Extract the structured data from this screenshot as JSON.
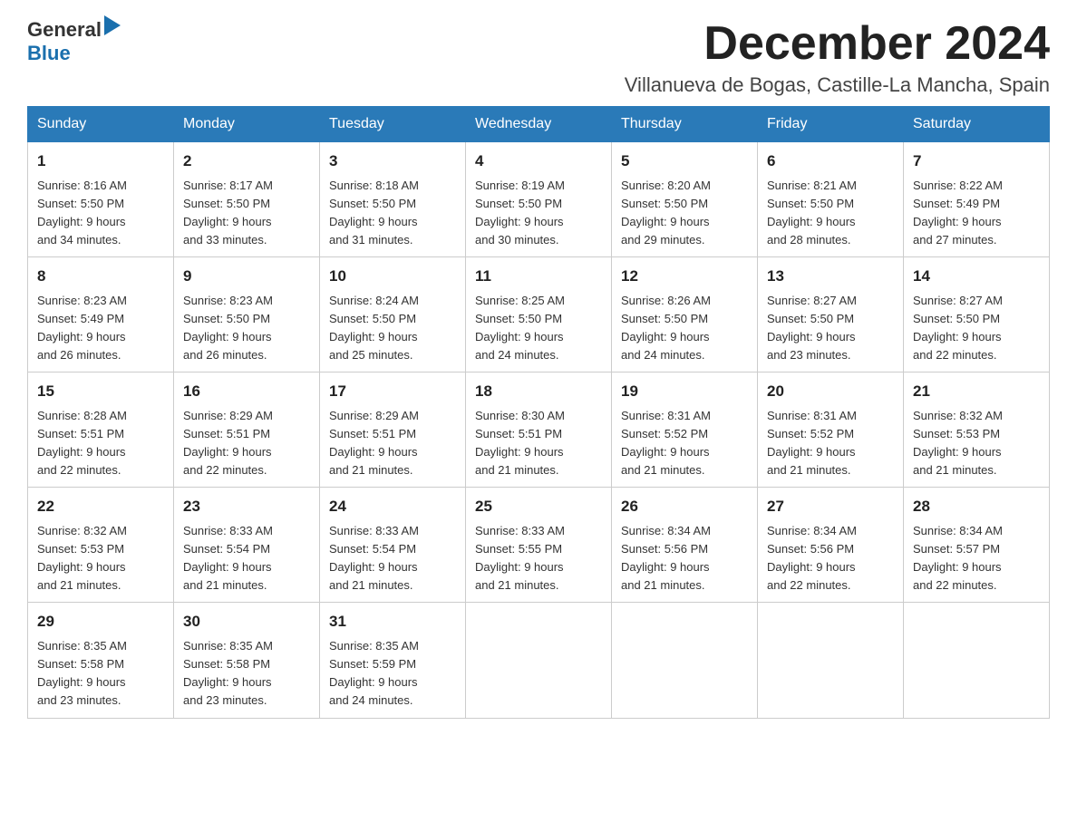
{
  "header": {
    "logo_general": "General",
    "logo_blue": "Blue",
    "month_title": "December 2024",
    "location": "Villanueva de Bogas, Castille-La Mancha, Spain"
  },
  "weekdays": [
    "Sunday",
    "Monday",
    "Tuesday",
    "Wednesday",
    "Thursday",
    "Friday",
    "Saturday"
  ],
  "weeks": [
    [
      {
        "day": "1",
        "sunrise": "8:16 AM",
        "sunset": "5:50 PM",
        "daylight": "9 hours and 34 minutes."
      },
      {
        "day": "2",
        "sunrise": "8:17 AM",
        "sunset": "5:50 PM",
        "daylight": "9 hours and 33 minutes."
      },
      {
        "day": "3",
        "sunrise": "8:18 AM",
        "sunset": "5:50 PM",
        "daylight": "9 hours and 31 minutes."
      },
      {
        "day": "4",
        "sunrise": "8:19 AM",
        "sunset": "5:50 PM",
        "daylight": "9 hours and 30 minutes."
      },
      {
        "day": "5",
        "sunrise": "8:20 AM",
        "sunset": "5:50 PM",
        "daylight": "9 hours and 29 minutes."
      },
      {
        "day": "6",
        "sunrise": "8:21 AM",
        "sunset": "5:50 PM",
        "daylight": "9 hours and 28 minutes."
      },
      {
        "day": "7",
        "sunrise": "8:22 AM",
        "sunset": "5:49 PM",
        "daylight": "9 hours and 27 minutes."
      }
    ],
    [
      {
        "day": "8",
        "sunrise": "8:23 AM",
        "sunset": "5:49 PM",
        "daylight": "9 hours and 26 minutes."
      },
      {
        "day": "9",
        "sunrise": "8:23 AM",
        "sunset": "5:50 PM",
        "daylight": "9 hours and 26 minutes."
      },
      {
        "day": "10",
        "sunrise": "8:24 AM",
        "sunset": "5:50 PM",
        "daylight": "9 hours and 25 minutes."
      },
      {
        "day": "11",
        "sunrise": "8:25 AM",
        "sunset": "5:50 PM",
        "daylight": "9 hours and 24 minutes."
      },
      {
        "day": "12",
        "sunrise": "8:26 AM",
        "sunset": "5:50 PM",
        "daylight": "9 hours and 24 minutes."
      },
      {
        "day": "13",
        "sunrise": "8:27 AM",
        "sunset": "5:50 PM",
        "daylight": "9 hours and 23 minutes."
      },
      {
        "day": "14",
        "sunrise": "8:27 AM",
        "sunset": "5:50 PM",
        "daylight": "9 hours and 22 minutes."
      }
    ],
    [
      {
        "day": "15",
        "sunrise": "8:28 AM",
        "sunset": "5:51 PM",
        "daylight": "9 hours and 22 minutes."
      },
      {
        "day": "16",
        "sunrise": "8:29 AM",
        "sunset": "5:51 PM",
        "daylight": "9 hours and 22 minutes."
      },
      {
        "day": "17",
        "sunrise": "8:29 AM",
        "sunset": "5:51 PM",
        "daylight": "9 hours and 21 minutes."
      },
      {
        "day": "18",
        "sunrise": "8:30 AM",
        "sunset": "5:51 PM",
        "daylight": "9 hours and 21 minutes."
      },
      {
        "day": "19",
        "sunrise": "8:31 AM",
        "sunset": "5:52 PM",
        "daylight": "9 hours and 21 minutes."
      },
      {
        "day": "20",
        "sunrise": "8:31 AM",
        "sunset": "5:52 PM",
        "daylight": "9 hours and 21 minutes."
      },
      {
        "day": "21",
        "sunrise": "8:32 AM",
        "sunset": "5:53 PM",
        "daylight": "9 hours and 21 minutes."
      }
    ],
    [
      {
        "day": "22",
        "sunrise": "8:32 AM",
        "sunset": "5:53 PM",
        "daylight": "9 hours and 21 minutes."
      },
      {
        "day": "23",
        "sunrise": "8:33 AM",
        "sunset": "5:54 PM",
        "daylight": "9 hours and 21 minutes."
      },
      {
        "day": "24",
        "sunrise": "8:33 AM",
        "sunset": "5:54 PM",
        "daylight": "9 hours and 21 minutes."
      },
      {
        "day": "25",
        "sunrise": "8:33 AM",
        "sunset": "5:55 PM",
        "daylight": "9 hours and 21 minutes."
      },
      {
        "day": "26",
        "sunrise": "8:34 AM",
        "sunset": "5:56 PM",
        "daylight": "9 hours and 21 minutes."
      },
      {
        "day": "27",
        "sunrise": "8:34 AM",
        "sunset": "5:56 PM",
        "daylight": "9 hours and 22 minutes."
      },
      {
        "day": "28",
        "sunrise": "8:34 AM",
        "sunset": "5:57 PM",
        "daylight": "9 hours and 22 minutes."
      }
    ],
    [
      {
        "day": "29",
        "sunrise": "8:35 AM",
        "sunset": "5:58 PM",
        "daylight": "9 hours and 23 minutes."
      },
      {
        "day": "30",
        "sunrise": "8:35 AM",
        "sunset": "5:58 PM",
        "daylight": "9 hours and 23 minutes."
      },
      {
        "day": "31",
        "sunrise": "8:35 AM",
        "sunset": "5:59 PM",
        "daylight": "9 hours and 24 minutes."
      },
      null,
      null,
      null,
      null
    ]
  ],
  "sunrise_label": "Sunrise:",
  "sunset_label": "Sunset:",
  "daylight_label": "Daylight:"
}
